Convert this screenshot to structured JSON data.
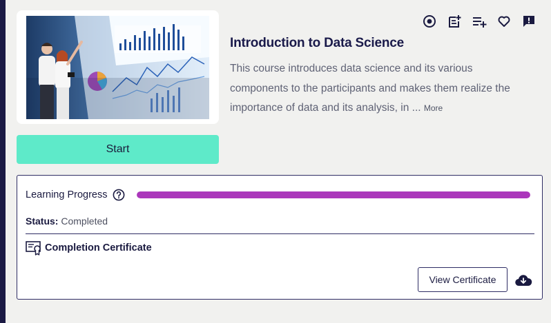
{
  "course": {
    "title": "Introduction to Data Science",
    "description": "This course introduces data science and its various components to the participants and makes them realize the importance of data and its analysis, in ...",
    "more_label": "More",
    "start_label": "Start",
    "thumbnail_icon": "presentation-photo"
  },
  "actions": [
    {
      "icon": "target-icon"
    },
    {
      "icon": "note-add-icon"
    },
    {
      "icon": "playlist-add-icon"
    },
    {
      "icon": "heart-icon"
    },
    {
      "icon": "feedback-icon"
    }
  ],
  "progress": {
    "label": "Learning Progress",
    "percent": 100,
    "status_label": "Status:",
    "status_value": "Completed"
  },
  "certificate": {
    "label": "Completion Certificate",
    "view_label": "View Certificate"
  },
  "colors": {
    "accent_green": "#5eeac9",
    "progress_purple": "#ab37bb",
    "navy": "#2d2b63"
  }
}
